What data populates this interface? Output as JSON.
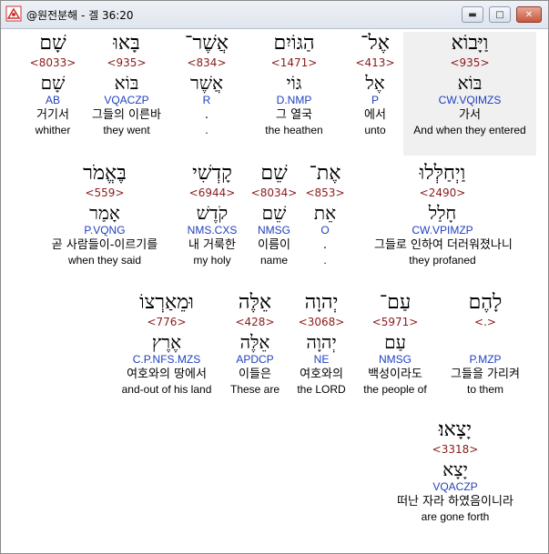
{
  "window": {
    "title": "@원전분해 - 겔 36:20"
  },
  "rows": [
    [
      {
        "heb": "שָׁם",
        "strong": "<8033>",
        "lemma": "שָׁם",
        "morph": "AB",
        "kor": "거기서",
        "eng": "whither"
      },
      {
        "heb": "בָּאוּ",
        "strong": "<935>",
        "lemma": "בּוֹא",
        "morph": "VQACZP",
        "kor": "그들의 이른바",
        "eng": "they went"
      },
      {
        "heb": "אֲשֶׁר־",
        "strong": "<834>",
        "lemma": "אֲשֶׁר",
        "morph": "R",
        "kor": ".",
        "eng": "."
      },
      {
        "heb": "הַגּוֹיִם",
        "strong": "<1471>",
        "lemma": "גּוֹי",
        "morph": "D.NMP",
        "kor": "그 열국",
        "eng": "the heathen"
      },
      {
        "heb": "אֶל־",
        "strong": "<413>",
        "lemma": "אֶל",
        "morph": "P",
        "kor": "에서",
        "eng": "unto"
      },
      {
        "heb": "וַיָּבוֹא",
        "strong": "<935>",
        "lemma": "בּוֹא",
        "morph": "CW.VQIMZS",
        "kor": "가서",
        "eng": "And when they entered"
      }
    ],
    [
      {
        "heb": "בֶּאֱמֹר",
        "strong": "<559>",
        "lemma": "אָמַר",
        "morph": "P.VQNG",
        "kor": "곧 사람들이-이르기를",
        "eng": "when they said"
      },
      {
        "heb": "קָדְשִׁי",
        "strong": "<6944>",
        "lemma": "קֹדֶשׁ",
        "morph": "NMS.CXS",
        "kor": "내 거룩한",
        "eng": "my holy"
      },
      {
        "heb": "שֵׁם",
        "strong": "<8034>",
        "lemma": "שֵׁם",
        "morph": "NMSG",
        "kor": "이름이",
        "eng": "name"
      },
      {
        "heb": "אֶת־",
        "strong": "<853>",
        "lemma": "אֵת",
        "morph": "O",
        "kor": ".",
        "eng": "."
      },
      {
        "heb": "וַיְחַלְּלוּ",
        "strong": "<2490>",
        "lemma": "חָלַל",
        "morph": "CW.VPIMZP",
        "kor": "그들로 인하여 더러워졌나니",
        "eng": "they profaned"
      }
    ],
    [
      {
        "heb": "וּמֵאַרְצוֹ",
        "strong": "<776>",
        "lemma": "אֶרֶץ",
        "morph": "C.P.NFS.MZS",
        "kor": "여호와의 땅에서",
        "eng": "and-out of his land"
      },
      {
        "heb": "אֵלֶּה",
        "strong": "<428>",
        "lemma": "אֵלֶּה",
        "morph": "APDCP",
        "kor": "이들은",
        "eng": "These are"
      },
      {
        "heb": "יְהוָה",
        "strong": "<3068>",
        "lemma": "יְהוָה",
        "morph": "NE",
        "kor": "여호와의",
        "eng": "the LORD"
      },
      {
        "heb": "עַם־",
        "strong": "<5971>",
        "lemma": "עַם",
        "morph": "NMSG",
        "kor": "백성이라도",
        "eng": "the people of"
      },
      {
        "heb": "לָהֶם",
        "strong": "<.>",
        "lemma": "",
        "morph": "P.MZP",
        "kor": "그들을 가리켜",
        "eng": "to them"
      }
    ],
    [
      {
        "heb": "יָצָאוּ׃",
        "strong": "<3318>",
        "lemma": "יָצָא",
        "morph": "VQACZP",
        "kor": "떠난 자라 하였음이니라",
        "eng": "are gone forth"
      }
    ]
  ],
  "colors": {
    "strong": "#8b1a1a",
    "morph": "#1f3fbf",
    "selected_bg": "#f0f0f0"
  }
}
